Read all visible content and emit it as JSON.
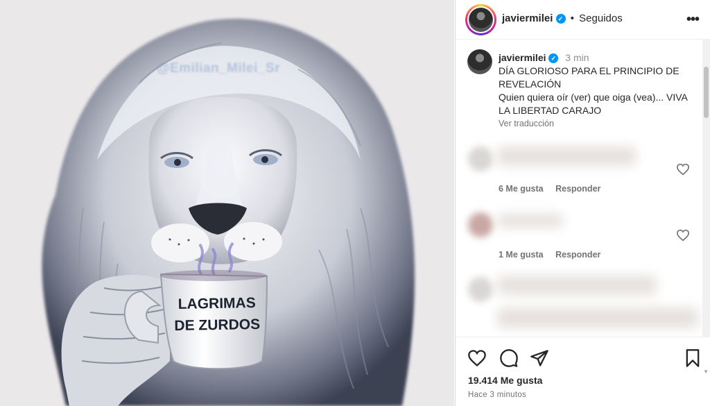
{
  "post_image": {
    "watermark": "@Emilian_Milei_Sr",
    "mug_text": [
      "LAGRIMAS",
      "DE ZURDOS"
    ]
  },
  "header": {
    "username": "javiermilei",
    "separator": "•",
    "follow_status": "Seguidos",
    "more_label": "•••"
  },
  "caption": {
    "username": "javiermilei",
    "time": "3 min",
    "lines": [
      "DÍA GLORIOSO PARA EL PRINCIPIO DE REVELACIÓN",
      "Quien quiera oír (ver) que oiga (vea)... VIVA LA LIBERTAD CARAJO"
    ],
    "see_translation": "Ver traducción"
  },
  "comments": [
    {
      "likes": "6 Me gusta",
      "reply": "Responder"
    },
    {
      "likes": "1 Me gusta",
      "reply": "Responder"
    },
    {
      "likes": "",
      "reply": ""
    }
  ],
  "footer": {
    "likes": "19.414 Me gusta",
    "posted": "Hace 3 minutos"
  },
  "icons": {
    "like": "heart-icon",
    "comment": "comment-bubble-icon",
    "share": "paper-plane-icon",
    "save": "bookmark-icon",
    "verified": "verified-badge-icon",
    "more": "more-options-icon"
  },
  "colors": {
    "verified_blue": "#0095f6",
    "text": "#262626",
    "secondary_text": "#737373"
  }
}
